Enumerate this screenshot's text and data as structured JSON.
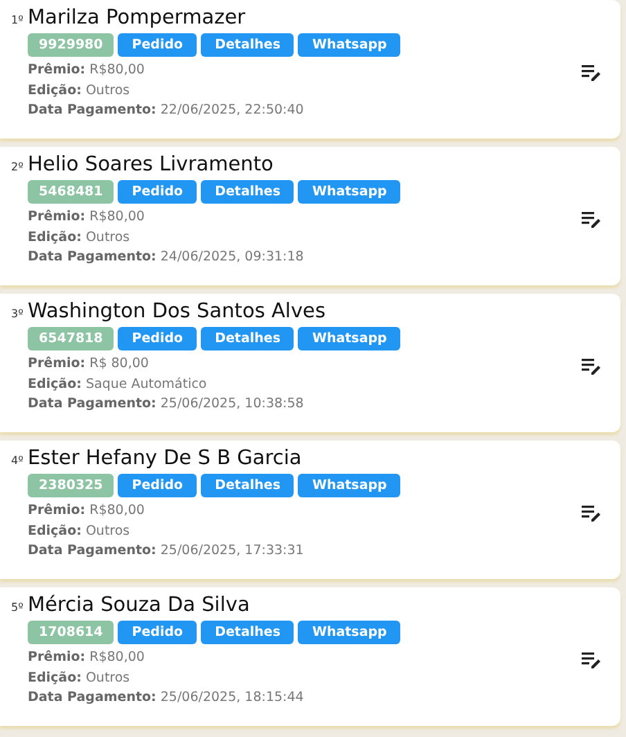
{
  "winners": [
    {
      "rank": "1º",
      "name": "Marilza Pompermazer",
      "code": "9929980",
      "buttons": [
        "Pedido",
        "Detalhes",
        "Whatsapp"
      ],
      "details": [
        "**Prêmio:** R$80,00",
        "**Edição:** Outros",
        "**Data Pagamento:** 22/06/2025, 22:50:40"
      ]
    },
    {
      "rank": "2º",
      "name": "Helio Soares Livramento",
      "code": "5468481",
      "buttons": [
        "Pedido",
        "Detalhes",
        "Whatsapp"
      ],
      "details": [
        "**Prêmio:** R$80,00",
        "**Edição:** Outros",
        "**Data Pagamento:** 24/06/2025, 09:31:18"
      ]
    },
    {
      "rank": "3º",
      "name": "Washington Dos Santos Alves",
      "code": "6547818",
      "buttons": [
        "Pedido",
        "Detalhes",
        "Whatsapp"
      ],
      "details": [
        "**Prêmio:** R$ 80,00",
        "**Edição:** Saque Automático",
        "**Data Pagamento:** 25/06/2025, 10:38:58"
      ]
    },
    {
      "rank": "4º",
      "name": "Ester Hefany De S B Garcia",
      "code": "2380325",
      "buttons": [
        "Pedido",
        "Detalhes",
        "Whatsapp"
      ],
      "details": [
        "**Prêmio:** R$80,00",
        "**Edição:** Outros",
        "**Data Pagamento:** 25/06/2025, 17:33:31"
      ]
    },
    {
      "rank": "5º",
      "name": "Mércia Souza Da Silva",
      "code": "1708614",
      "buttons": [
        "Pedido",
        "Detalhes",
        "Whatsapp"
      ],
      "details": [
        "**Prêmio:** R$80,00",
        "**Edição:** Outros",
        "**Data Pagamento:** 25/06/2025, 18:15:44"
      ]
    }
  ]
}
